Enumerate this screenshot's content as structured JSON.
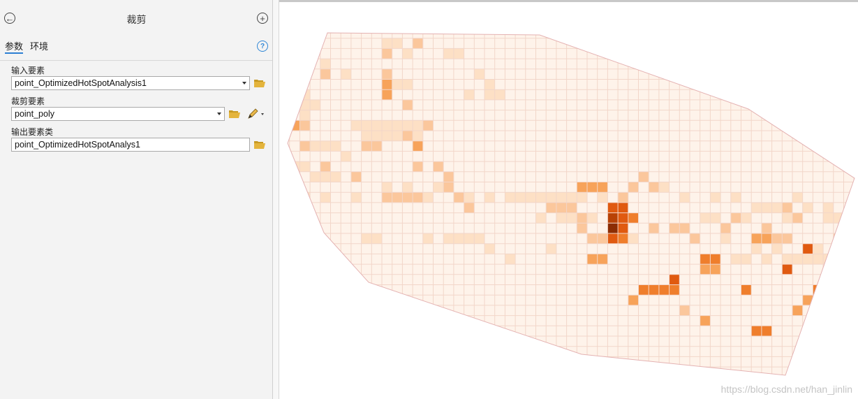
{
  "panel": {
    "title": "裁剪",
    "back_icon": "back-arrow-icon",
    "add_icon": "add-icon",
    "tabs": [
      {
        "label": "参数",
        "active": true
      },
      {
        "label": "环境",
        "active": false
      }
    ],
    "help_icon": "help-icon"
  },
  "params": {
    "input_features": {
      "label": "输入要素",
      "value": "point_OptimizedHotSpotAnalysis1"
    },
    "clip_features": {
      "label": "裁剪要素",
      "value": "point_poly"
    },
    "output_class": {
      "label": "输出要素类",
      "value": "point_OptimizedHotSpotAnalys1"
    }
  },
  "map": {
    "outline_color": "#e4b2b2",
    "cell_base_color": "#fef3ea",
    "grid_color": "#f2d6c9",
    "watermark": "https://blog.csdn.net/han_jinlin",
    "palette": [
      "#fef3ea",
      "#fde0c5",
      "#fbc79c",
      "#f7a35a",
      "#ef7e2c",
      "#e05a10",
      "#b84206",
      "#8c2d03"
    ]
  }
}
